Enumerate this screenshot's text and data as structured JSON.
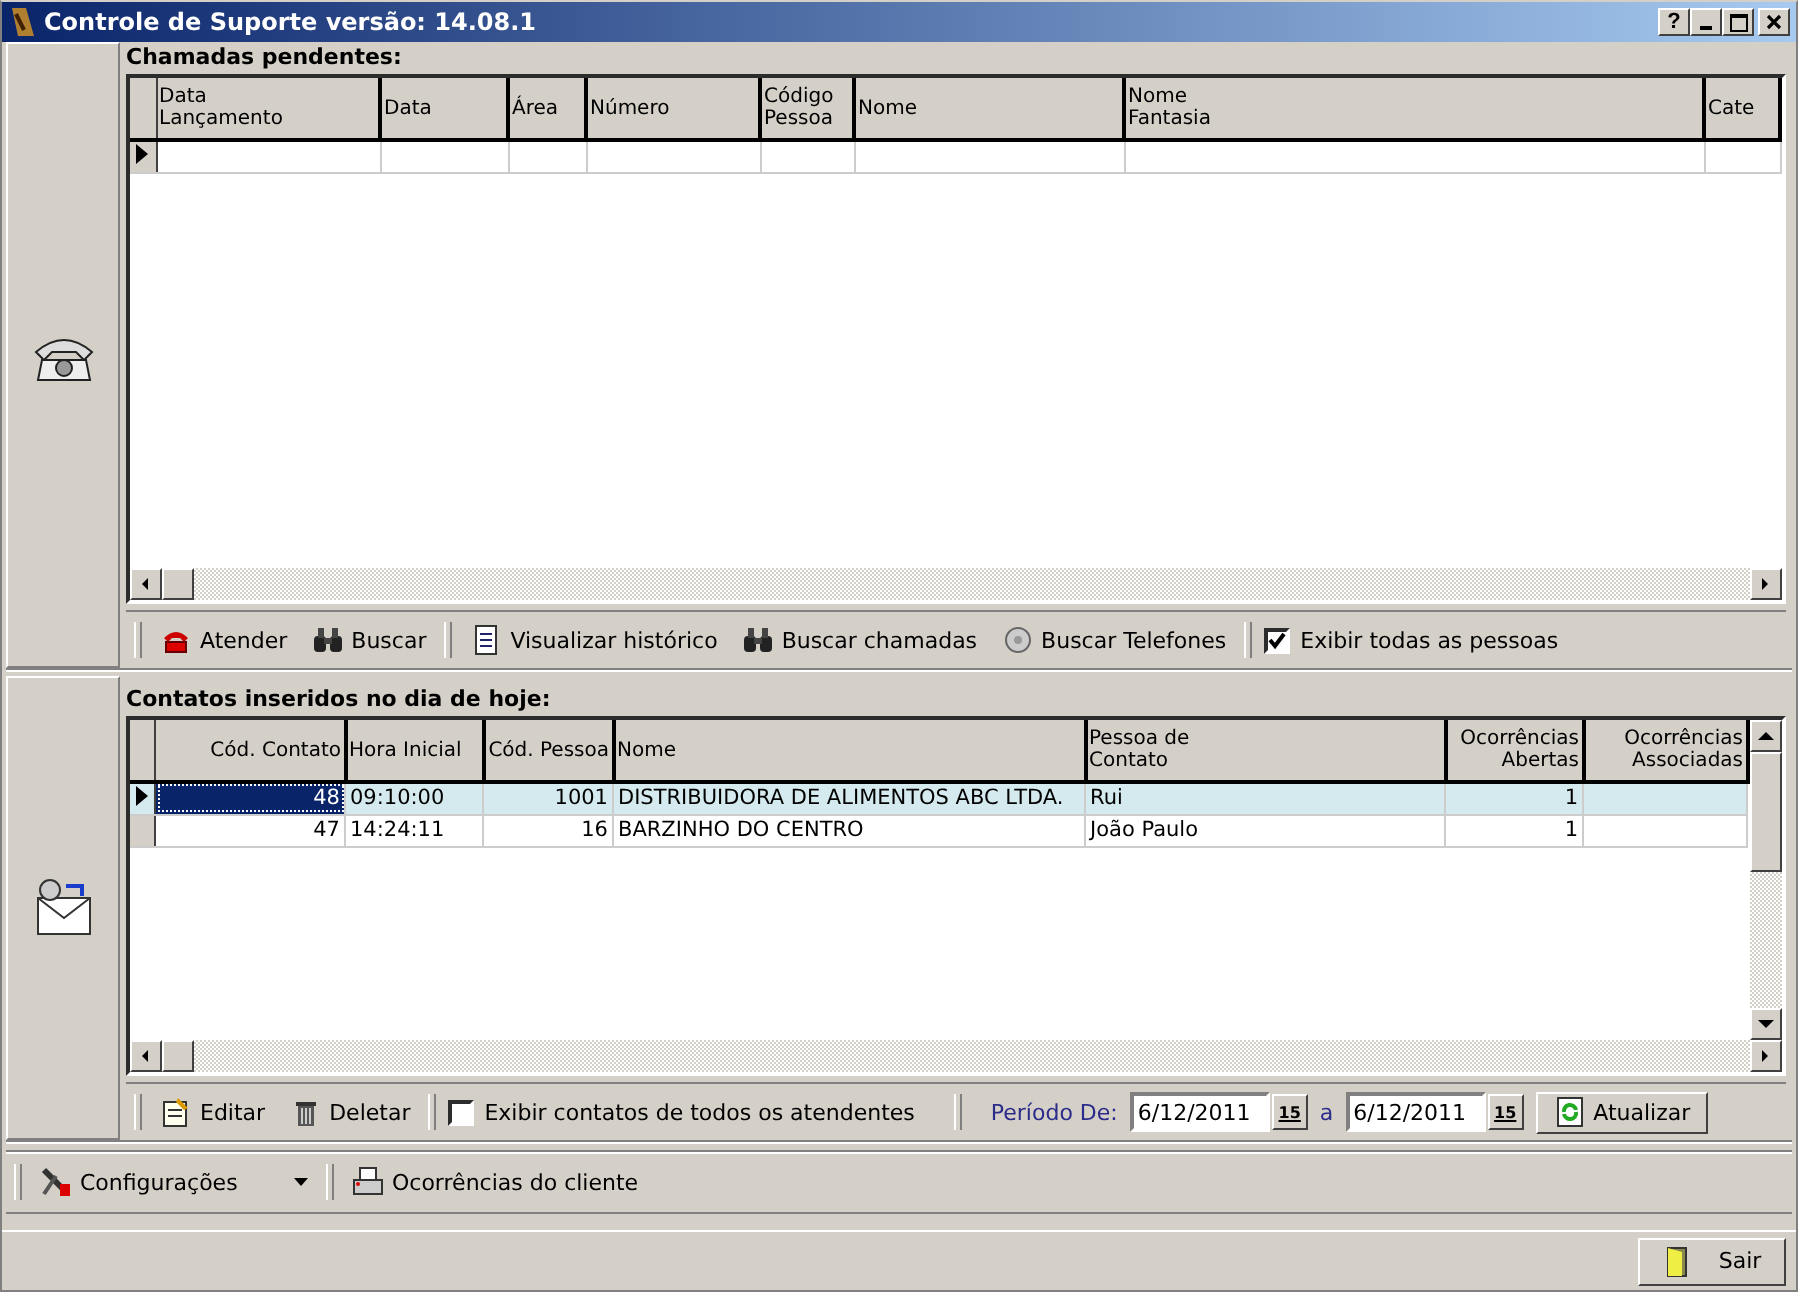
{
  "window": {
    "title": "Controle de Suporte versão: 14.08.1",
    "help": "?"
  },
  "pending_calls": {
    "title": "Chamadas pendentes:",
    "columns": [
      "Data\nLançamento",
      "Data",
      "Área",
      "Número",
      "Código\nPessoa",
      "Nome",
      "Nome\nFantasia",
      "Cate"
    ]
  },
  "pending_toolbar": {
    "buttons": [
      {
        "label": "Atender",
        "kind": "phone"
      },
      {
        "label": "Buscar",
        "kind": "binoculars"
      },
      {
        "label": "Visualizar histórico",
        "kind": "notepad"
      },
      {
        "label": "Buscar chamadas",
        "kind": "binoculars"
      },
      {
        "label": "Buscar Telefones",
        "kind": "dial"
      }
    ],
    "checkbox": {
      "label": "Exibir todas as pessoas",
      "checked": true
    }
  },
  "contacts": {
    "title": "Contatos inseridos no dia de hoje:",
    "columns": [
      "Cód. Contato",
      "Hora Inicial",
      "Cód. Pessoa",
      "Nome",
      "Pessoa de\nContato",
      "Ocorrências\nAbertas",
      "Ocorrências\nAssociadas"
    ],
    "rows": [
      {
        "cells": [
          "48",
          "09:10:00",
          "1001",
          "DISTRIBUIDORA DE ALIMENTOS ABC LTDA.",
          "Rui",
          "1",
          ""
        ],
        "selected": true
      },
      {
        "cells": [
          "47",
          "14:24:11",
          "16",
          "BARZINHO DO CENTRO",
          "João Paulo",
          "1",
          ""
        ],
        "selected": false
      }
    ]
  },
  "contacts_toolbar": {
    "buttons": [
      {
        "label": "Editar",
        "kind": "edit"
      },
      {
        "label": "Deletar",
        "kind": "trash"
      }
    ],
    "checkbox": {
      "label": "Exibir contatos de todos os atendentes",
      "checked": false
    },
    "period_label": "Período De:",
    "from": {
      "value": "6/12/2011",
      "button": "15"
    },
    "separator": "a",
    "to": {
      "value": "6/12/2011",
      "button": "15"
    },
    "refresh": "Atualizar"
  },
  "bottom_toolbar": {
    "settings": "Configurações",
    "client": "Ocorrências do cliente"
  },
  "footer": {
    "exit": "Sair"
  }
}
